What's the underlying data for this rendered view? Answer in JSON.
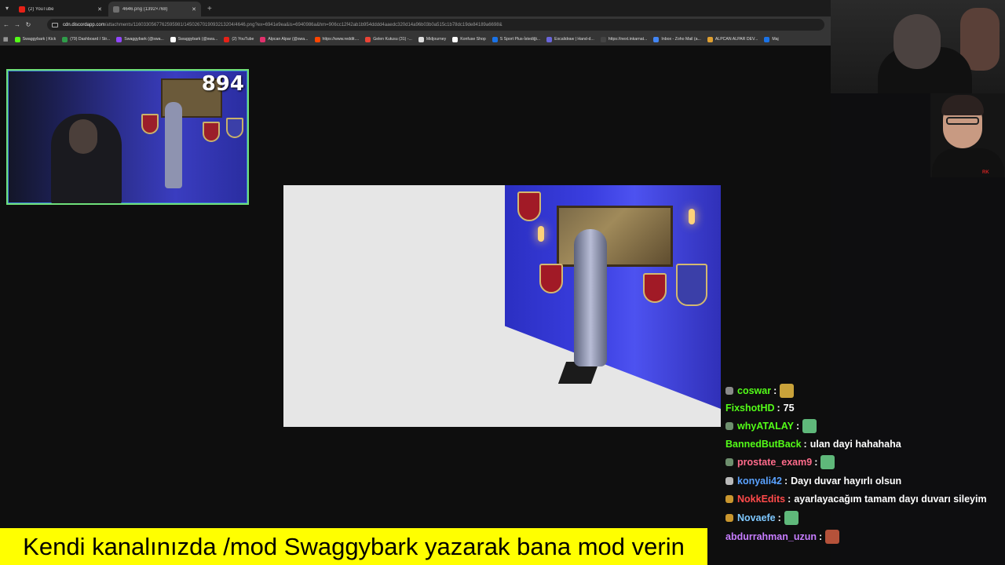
{
  "browser": {
    "tabs": [
      {
        "title": "(2) YouTube",
        "favicon": "youtube-icon",
        "active": false
      },
      {
        "title": "4646.png (1392×768)",
        "favicon": "image-icon",
        "active": true
      }
    ],
    "address": {
      "host": "cdn.discordapp.com",
      "path": "/attachments/1160330567762595981/1450267019093213204/4646.png?ex=6941e9ea&is=6940986a&hm=906cc12f42ab1b954dddd4aaedc320d14a96b03b0a515c1b78dc19de84189a6698&"
    },
    "bookmarks": [
      {
        "label": "Swaggybark | Kick",
        "color": "#53fc18"
      },
      {
        "label": "(79) Dashboard / Str...",
        "color": "#2f9c4a"
      },
      {
        "label": "Swaggybark (@swa...",
        "color": "#9146ff"
      },
      {
        "label": "Swaggybark (@swa...",
        "color": "#ffffff"
      },
      {
        "label": "(2) YouTube",
        "color": "#e62117"
      },
      {
        "label": "Alpcan Alpar (@swa...",
        "color": "#e1306c"
      },
      {
        "label": "https://www.reddit....",
        "color": "#ff4500"
      },
      {
        "label": "Gelen Kutusu (31) -...",
        "color": "#ea4335"
      },
      {
        "label": "Midjourney",
        "color": "#dddddd"
      },
      {
        "label": "Konfuse Shop",
        "color": "#ffffff"
      },
      {
        "label": "S Sport Plus-İstediği...",
        "color": "#1a73e8"
      },
      {
        "label": "Excalidraw | Hand-d...",
        "color": "#6965db"
      },
      {
        "label": "https://next.inkarnat...",
        "color": "#444444"
      },
      {
        "label": "Inbox - Zoho Mail (a...",
        "color": "#4285f4"
      },
      {
        "label": "ALPCAN ALPAR DEV...",
        "color": "#e0a030"
      },
      {
        "label": "Maj",
        "color": "#1a73e8"
      }
    ]
  },
  "webcam": {
    "counter": "894"
  },
  "chat": {
    "messages": [
      {
        "user": "coswar",
        "text": "",
        "user_color": "#53fc18",
        "badge_color": "#8a8a8a",
        "emote_color": "#c9a23a"
      },
      {
        "user": "FixshotHD",
        "text": "75",
        "user_color": "#53fc18",
        "badge_color": "",
        "emote_color": ""
      },
      {
        "user": "whyATALAY",
        "text": "",
        "user_color": "#53fc18",
        "badge_color": "#6e8f6e",
        "emote_color": "#5fb87a"
      },
      {
        "user": "BannedButBack",
        "text": "ulan dayi hahahaha",
        "user_color": "#53fc18",
        "badge_color": "",
        "emote_color": ""
      },
      {
        "user": "prostate_exam9",
        "text": "",
        "user_color": "#ff6b8b",
        "badge_color": "#6e8f6e",
        "emote_color": "#5fb87a"
      },
      {
        "user": "konyali42",
        "text": "Dayı duvar hayırlı olsun",
        "user_color": "#5aa2ff",
        "badge_color": "#b9b9b9",
        "emote_color": ""
      },
      {
        "user": "NokkEdits",
        "text": "ayarlayacağım tamam dayı duvarı sileyim",
        "user_color": "#ff4a4a",
        "badge_color": "#c9962e",
        "emote_color": ""
      },
      {
        "user": "Novaefe",
        "text": "",
        "user_color": "#7ec8ff",
        "badge_color": "#c9962e",
        "emote_color": "#5fb87a"
      },
      {
        "user": "abdurrahman_uzun",
        "text": "",
        "user_color": "#c77dff",
        "badge_color": "",
        "emote_color": "#b5523a"
      }
    ]
  },
  "banner": {
    "text": "Kendi kanalınızda /mod Swaggybark yazarak bana mod verin"
  }
}
